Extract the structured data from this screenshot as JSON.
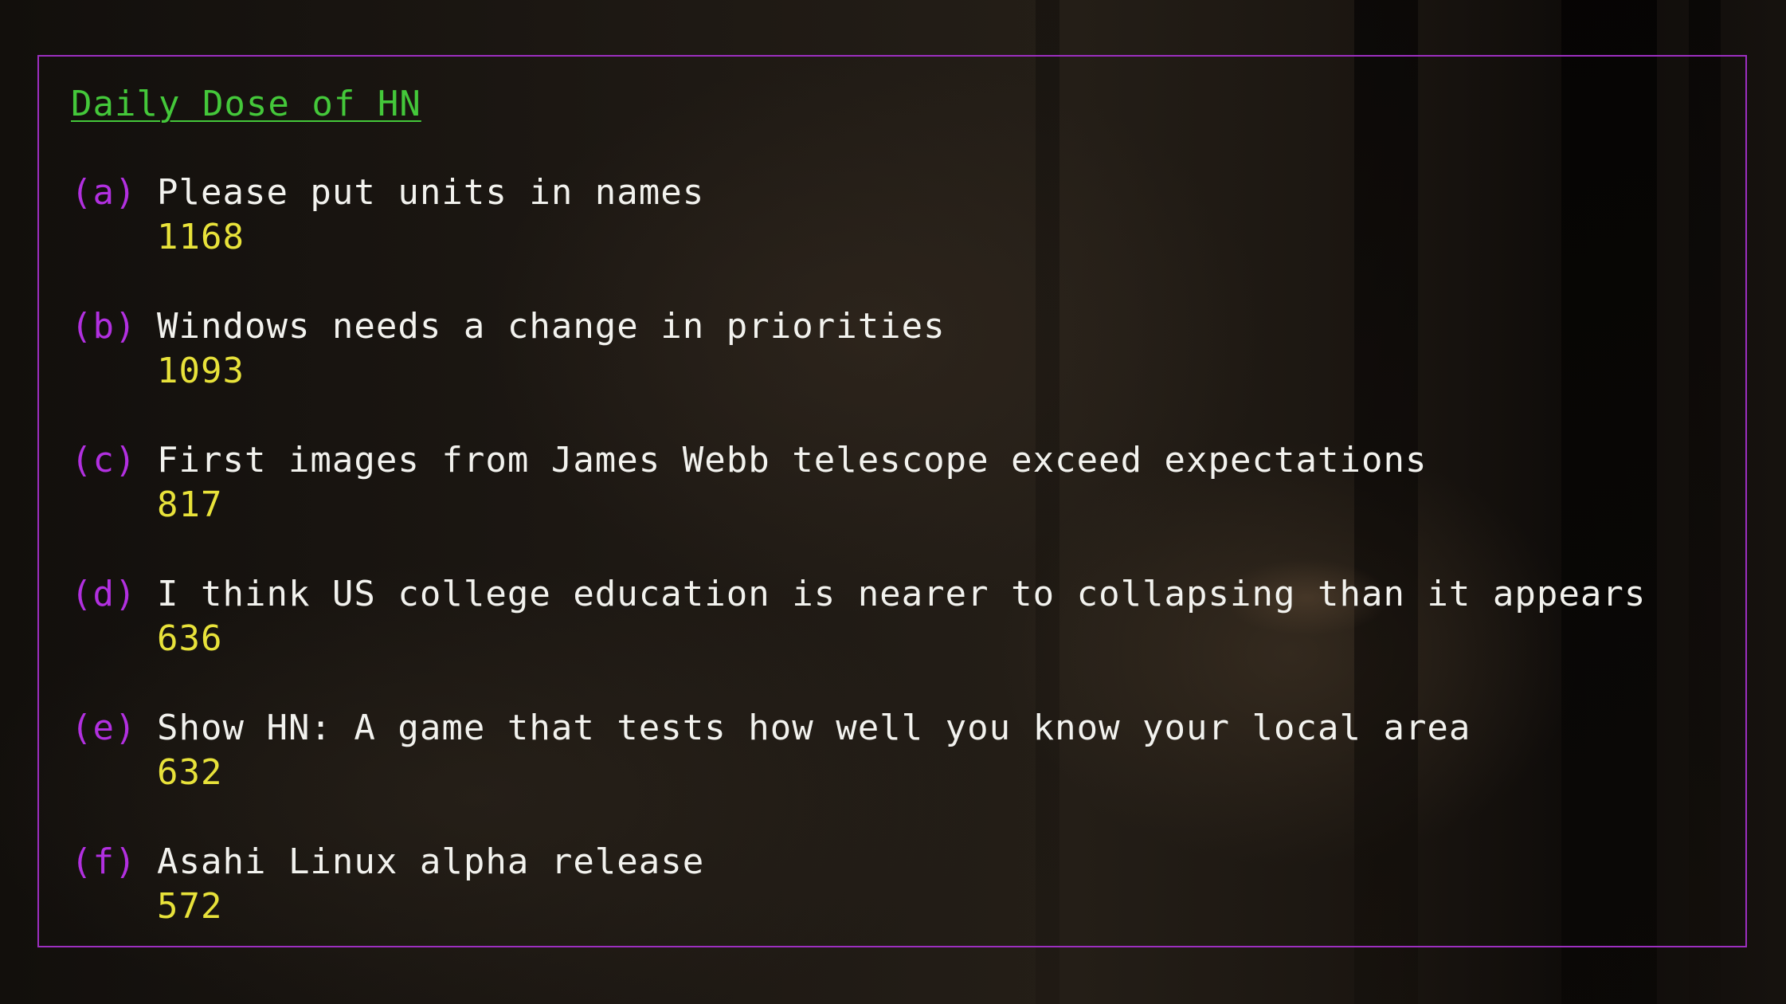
{
  "header": {
    "title": "Daily Dose of HN"
  },
  "stories": [
    {
      "letter": "(a)",
      "title": "Please put units in names",
      "points": "1168"
    },
    {
      "letter": "(b)",
      "title": "Windows needs a change in priorities",
      "points": "1093"
    },
    {
      "letter": "(c)",
      "title": "First images from James Webb telescope exceed expectations",
      "points": "817"
    },
    {
      "letter": "(d)",
      "title": "I think US college education is nearer to collapsing than it appears",
      "points": "636"
    },
    {
      "letter": "(e)",
      "title": "Show HN: A game that tests how well you know your local area",
      "points": "632"
    },
    {
      "letter": "(f)",
      "title": "Asahi Linux alpha release",
      "points": "572"
    }
  ],
  "colors": {
    "frame": "#9c2fc0",
    "title": "#44c83a",
    "letter": "#b230e0",
    "headline": "#f2f2ee",
    "points": "#e8e23a"
  }
}
